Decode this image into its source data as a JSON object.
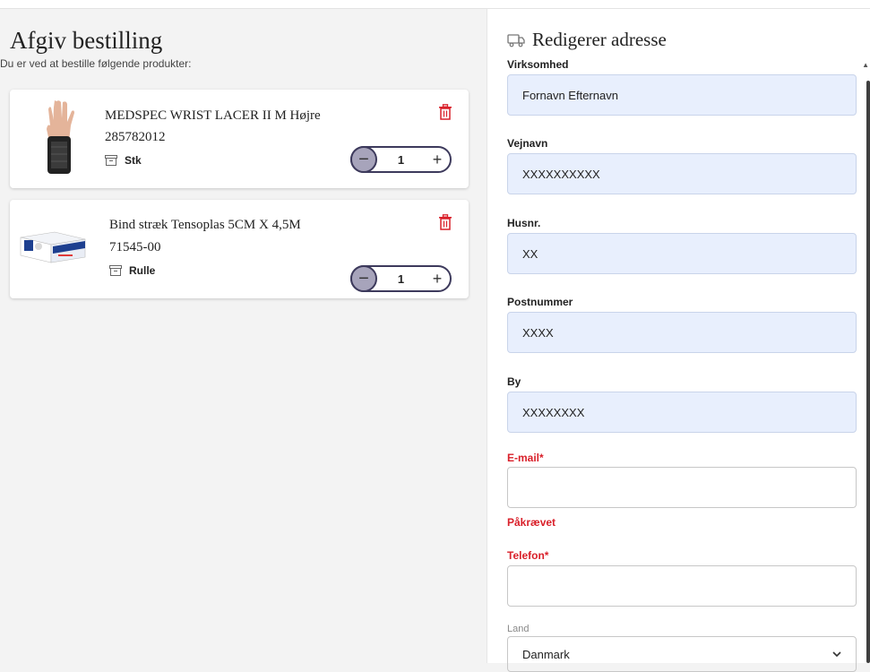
{
  "order": {
    "title": "Afgiv bestilling",
    "subtitle": "Du er ved at bestille følgende produkter:",
    "items": [
      {
        "name": "MEDSPEC WRIST LACER II M Højre",
        "sku": "285782012",
        "unit": "Stk",
        "quantity": "1",
        "thumbnail": "wrist-brace-image"
      },
      {
        "name": "Bind stræk Tensoplas 5CM X 4,5M",
        "sku": "71545-00",
        "unit": "Rulle",
        "quantity": "1",
        "thumbnail": "bandage-box-image"
      }
    ],
    "icons": {
      "unit": "package-icon",
      "delete": "trash-icon",
      "decrement": "minus-icon",
      "increment": "plus-icon"
    }
  },
  "address": {
    "title": "Redigerer adresse",
    "header_icon": "delivery-truck-icon",
    "fields": {
      "company": {
        "label": "Virksomhed",
        "value": "Fornavn Efternavn"
      },
      "street": {
        "label": "Vejnavn",
        "value": "XXXXXXXXXX"
      },
      "house_no": {
        "label": "Husnr.",
        "value": "XX"
      },
      "postcode": {
        "label": "Postnummer",
        "value": "XXXX"
      },
      "city": {
        "label": "By",
        "value": "XXXXXXXX"
      },
      "email": {
        "label": "E-mail*",
        "value": "",
        "error": "Påkrævet"
      },
      "phone": {
        "label": "Telefon*",
        "value": ""
      },
      "country": {
        "label": "Land",
        "value": "Danmark"
      }
    }
  },
  "colors": {
    "accent": "#3d3a5c",
    "accent_light": "#a7a4bb",
    "error": "#d9202a",
    "input_filled": "#e8effd",
    "background": "#f3f3f3"
  }
}
